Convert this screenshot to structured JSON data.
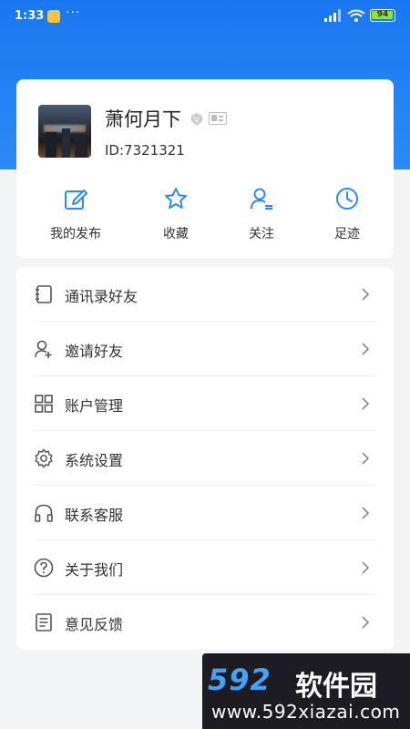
{
  "status_bar": {
    "time": "1:33",
    "dots": "···",
    "battery": "94"
  },
  "profile": {
    "nickname": "萧何月下",
    "user_id": "ID:7321321",
    "badge": "V"
  },
  "quick_actions": [
    {
      "label": "我的发布",
      "icon": "edit-icon"
    },
    {
      "label": "收藏",
      "icon": "star-icon"
    },
    {
      "label": "关注",
      "icon": "user-follow-icon"
    },
    {
      "label": "足迹",
      "icon": "clock-icon"
    }
  ],
  "menu": [
    {
      "label": "通讯录好友",
      "icon": "contacts-book-icon"
    },
    {
      "label": "邀请好友",
      "icon": "invite-user-icon"
    },
    {
      "label": "账户管理",
      "icon": "grid-icon"
    },
    {
      "label": "系统设置",
      "icon": "gear-icon"
    },
    {
      "label": "联系客服",
      "icon": "headphones-icon"
    },
    {
      "label": "关于我们",
      "icon": "question-icon"
    },
    {
      "label": "意见反馈",
      "icon": "document-icon"
    }
  ],
  "watermark": {
    "logo": "592",
    "brand": "软件园",
    "url": "www.592xiazai.com"
  },
  "colors": {
    "accent": "#1a77f2",
    "icon": "#2b8cf5",
    "menu_icon": "#555555",
    "watermark_logo": "#3fa3ff"
  }
}
